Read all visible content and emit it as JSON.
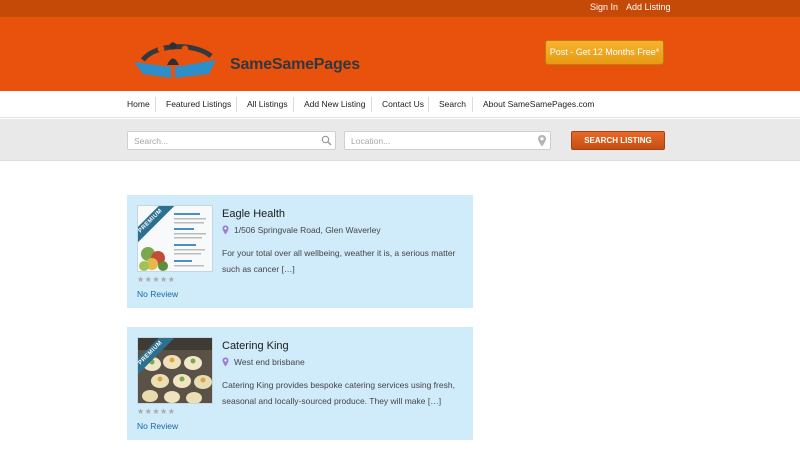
{
  "topbar": {
    "sign_in": "Sign In",
    "add_listing": "Add Listing"
  },
  "header": {
    "logo_text": "SameSamePages",
    "post_button": "Post - Get 12 Months Free*"
  },
  "nav": {
    "items": [
      "Home",
      "Featured Listings",
      "All Listings",
      "Add New Listing",
      "Contact Us",
      "Search",
      "About SameSamePages.com"
    ]
  },
  "search": {
    "keyword_placeholder": "Search...",
    "location_placeholder": "Location...",
    "button_label": "SEARCH LISTING"
  },
  "listings": [
    {
      "badge": "PREMIUM",
      "title": "Eagle Health",
      "address": "1/506 Springvale Road, Glen Waverley",
      "description": "For your total over all wellbeing, weather it is, a serious matter such as cancer […]",
      "rating_stars": 0,
      "review_label": "No Review"
    },
    {
      "badge": "PREMIUM",
      "title": "Catering King",
      "address": "West end brisbane",
      "description": "Catering King provides bespoke catering services using fresh, seasonal and locally-sourced produce. They will make […]",
      "rating_stars": 0,
      "review_label": "No Review"
    }
  ],
  "colors": {
    "brand_orange": "#e8520c",
    "topbar": "#c64a07",
    "post_button": "#f0a520",
    "card_bg": "#d0ecfb",
    "link_blue": "#1b66a4",
    "ribbon": "#2c6f8f"
  }
}
